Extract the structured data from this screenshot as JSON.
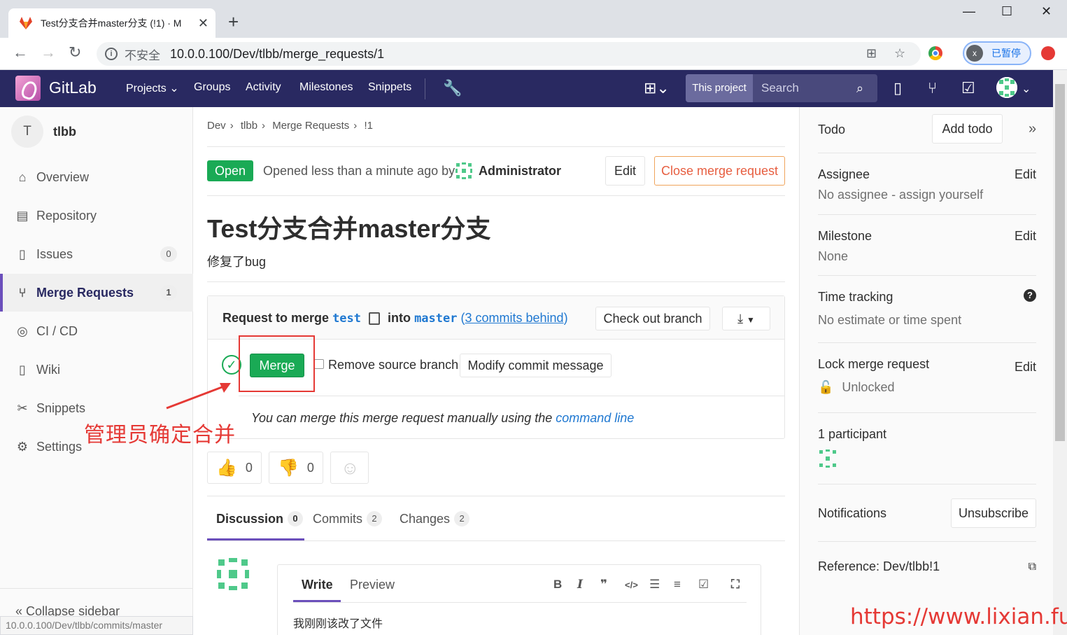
{
  "browser": {
    "tab_title": "Test分支合并master分支 (!1) · M",
    "url_insecure": "不安全",
    "url": "10.0.0.100/Dev/tlbb/merge_requests/1",
    "profile_initial": "x",
    "profile_label": "已暂停",
    "status_url": "10.0.0.100/Dev/tlbb/commits/master"
  },
  "header": {
    "brand": "GitLab",
    "nav": [
      "Projects",
      "Groups",
      "Activity",
      "Milestones",
      "Snippets"
    ],
    "search_scope": "This project",
    "search_placeholder": "Search"
  },
  "sidebar": {
    "project_initial": "T",
    "project_name": "tlbb",
    "items": [
      {
        "label": "Overview",
        "icon": "home-icon"
      },
      {
        "label": "Repository",
        "icon": "book-icon"
      },
      {
        "label": "Issues",
        "icon": "issues-icon",
        "count": "0"
      },
      {
        "label": "Merge Requests",
        "icon": "merge-request-icon",
        "count": "1"
      },
      {
        "label": "CI / CD",
        "icon": "rocket-icon"
      },
      {
        "label": "Wiki",
        "icon": "wiki-icon"
      },
      {
        "label": "Snippets",
        "icon": "scissors-icon"
      },
      {
        "label": "Settings",
        "icon": "gear-icon"
      }
    ],
    "collapse": "Collapse sidebar"
  },
  "breadcrumb": [
    "Dev",
    "tlbb",
    "Merge Requests",
    "!1"
  ],
  "mr": {
    "status": "Open",
    "opened_text": "Opened less than a minute ago by",
    "author": "Administrator",
    "edit": "Edit",
    "close": "Close merge request",
    "title": "Test分支合并master分支",
    "description": "修复了bug"
  },
  "widget": {
    "request_prefix": "Request to merge",
    "source": "test",
    "into": "into",
    "target": "master",
    "behind": "3 commits behind",
    "checkout": "Check out branch",
    "merge": "Merge",
    "remove_source": "Remove source branch",
    "modify_commit": "Modify commit message",
    "manual_text": "You can merge this merge request manually using the",
    "command_line": "command line"
  },
  "annotation": "管理员确定合并",
  "awards": {
    "up": "0",
    "down": "0"
  },
  "tabs": [
    {
      "label": "Discussion",
      "count": "0"
    },
    {
      "label": "Commits",
      "count": "2"
    },
    {
      "label": "Changes",
      "count": "2"
    }
  ],
  "note": {
    "write": "Write",
    "preview": "Preview",
    "text": "我刚刚该改了文件"
  },
  "right": {
    "todo": "Todo",
    "add_todo": "Add todo",
    "assignee": "Assignee",
    "assignee_value": "No assignee - assign yourself",
    "milestone": "Milestone",
    "milestone_value": "None",
    "time_tracking": "Time tracking",
    "time_value": "No estimate or time spent",
    "lock": "Lock merge request",
    "lock_value": "Unlocked",
    "participants": "1 participant",
    "notifications": "Notifications",
    "unsubscribe": "Unsubscribe",
    "reference": "Reference: Dev/tlbb!1",
    "edit": "Edit"
  },
  "watermark": "https://www.lixian.fun",
  "colors": {
    "header": "#292961",
    "success": "#1aaa55",
    "link": "#1f78d1",
    "annotation": "#e53935"
  }
}
